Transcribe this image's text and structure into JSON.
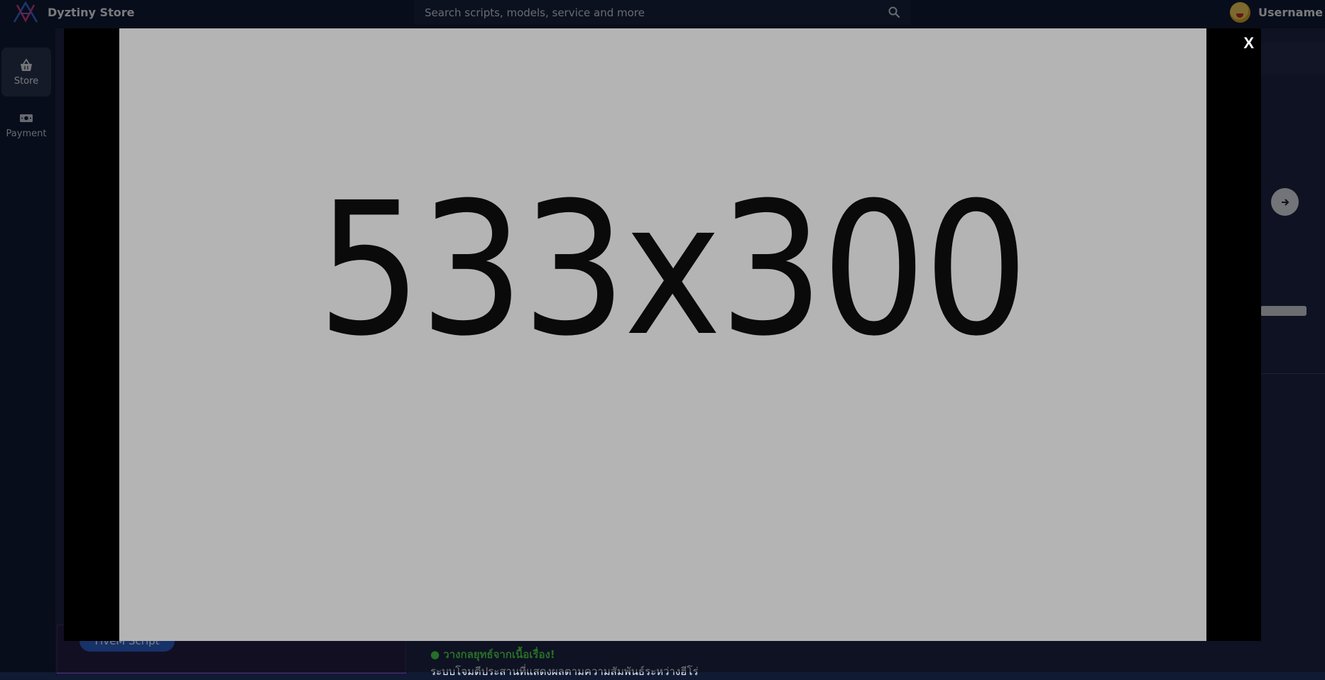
{
  "header": {
    "brand": "Dyztiny Store",
    "search_placeholder": "Search scripts, models, service and more",
    "username": "Username"
  },
  "sidebar": {
    "items": [
      {
        "label": "Store",
        "icon": "basket-icon",
        "active": true
      },
      {
        "label": "Payment",
        "icon": "banknote-icon",
        "active": false
      }
    ]
  },
  "background": {
    "card_badge": "FiveM Script",
    "highlight_text": "● วางกลยุทธ์จากเนื้อเรื่อง!",
    "body_text": "ระบบโจมตีประสานที่แสดงผลตามความสัมพันธ์ระหว่างฮีโร่"
  },
  "modal": {
    "image_text": "533x300",
    "close_label": "X"
  },
  "colors": {
    "page_bg": "#101a33",
    "bar_bg": "#0f1a35",
    "accent_blue": "#2f63d3",
    "accent_green": "#4fdc4f",
    "placeholder_gray": "#b4b4b4"
  }
}
